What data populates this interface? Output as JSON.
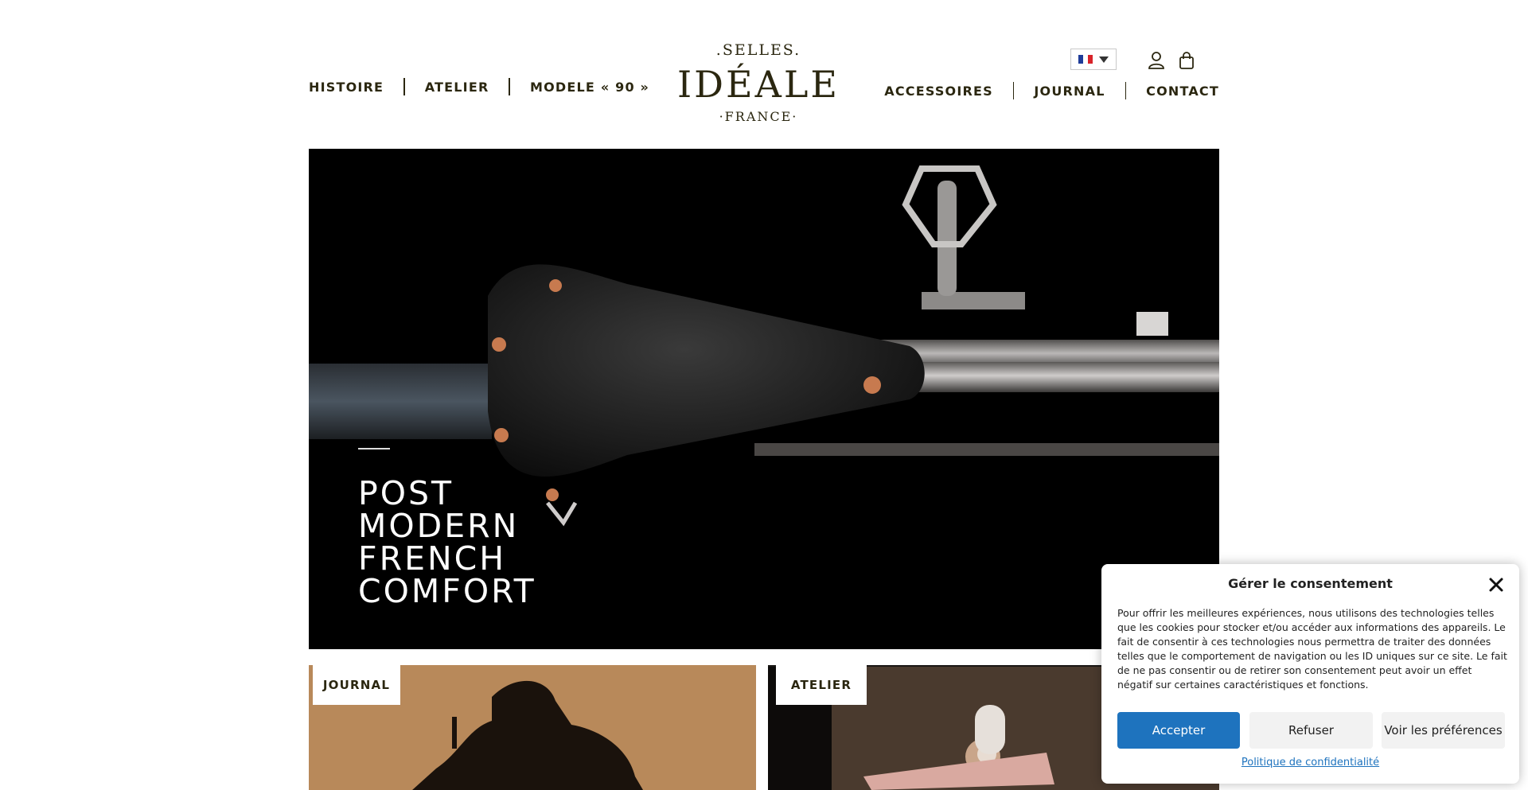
{
  "header": {
    "nav_left": [
      {
        "label": "HISTOIRE"
      },
      {
        "label": "ATELIER"
      },
      {
        "label": "MODELE « 90 »"
      }
    ],
    "nav_right": [
      {
        "label": "ACCESSOIRES"
      },
      {
        "label": "JOURNAL"
      },
      {
        "label": "CONTACT"
      }
    ],
    "logo": {
      "top": ".SELLES.",
      "main": "IDÉALE",
      "bottom": "·FRANCE·"
    },
    "language": {
      "selected": "fr"
    }
  },
  "hero": {
    "title_lines": [
      "POST",
      "MODERN",
      "FRENCH",
      "COMFORT"
    ]
  },
  "cards": [
    {
      "tag": "JOURNAL"
    },
    {
      "tag": "ATELIER"
    }
  ],
  "consent": {
    "title": "Gérer le consentement",
    "text": "Pour offrir les meilleures expériences, nous utilisons des technologies telles que les cookies pour stocker et/ou accéder aux informations des appareils. Le fait de consentir à ces technologies nous permettra de traiter des données telles que le comportement de navigation ou les ID uniques sur ce site. Le fait de ne pas consentir ou de retirer son consentement peut avoir un effet négatif sur certaines caractéristiques et fonctions.",
    "accept_label": "Accepter",
    "refuse_label": "Refuser",
    "prefs_label": "Voir les préférences",
    "policy_link": "Politique de confidentialité"
  },
  "colors": {
    "brand_text": "#2b2710",
    "accent_button": "#1e73be",
    "hero_bg": "#000000"
  },
  "icons": [
    "user-icon",
    "cart-icon",
    "close-icon",
    "france-flag-icon",
    "chevron-down-icon"
  ]
}
